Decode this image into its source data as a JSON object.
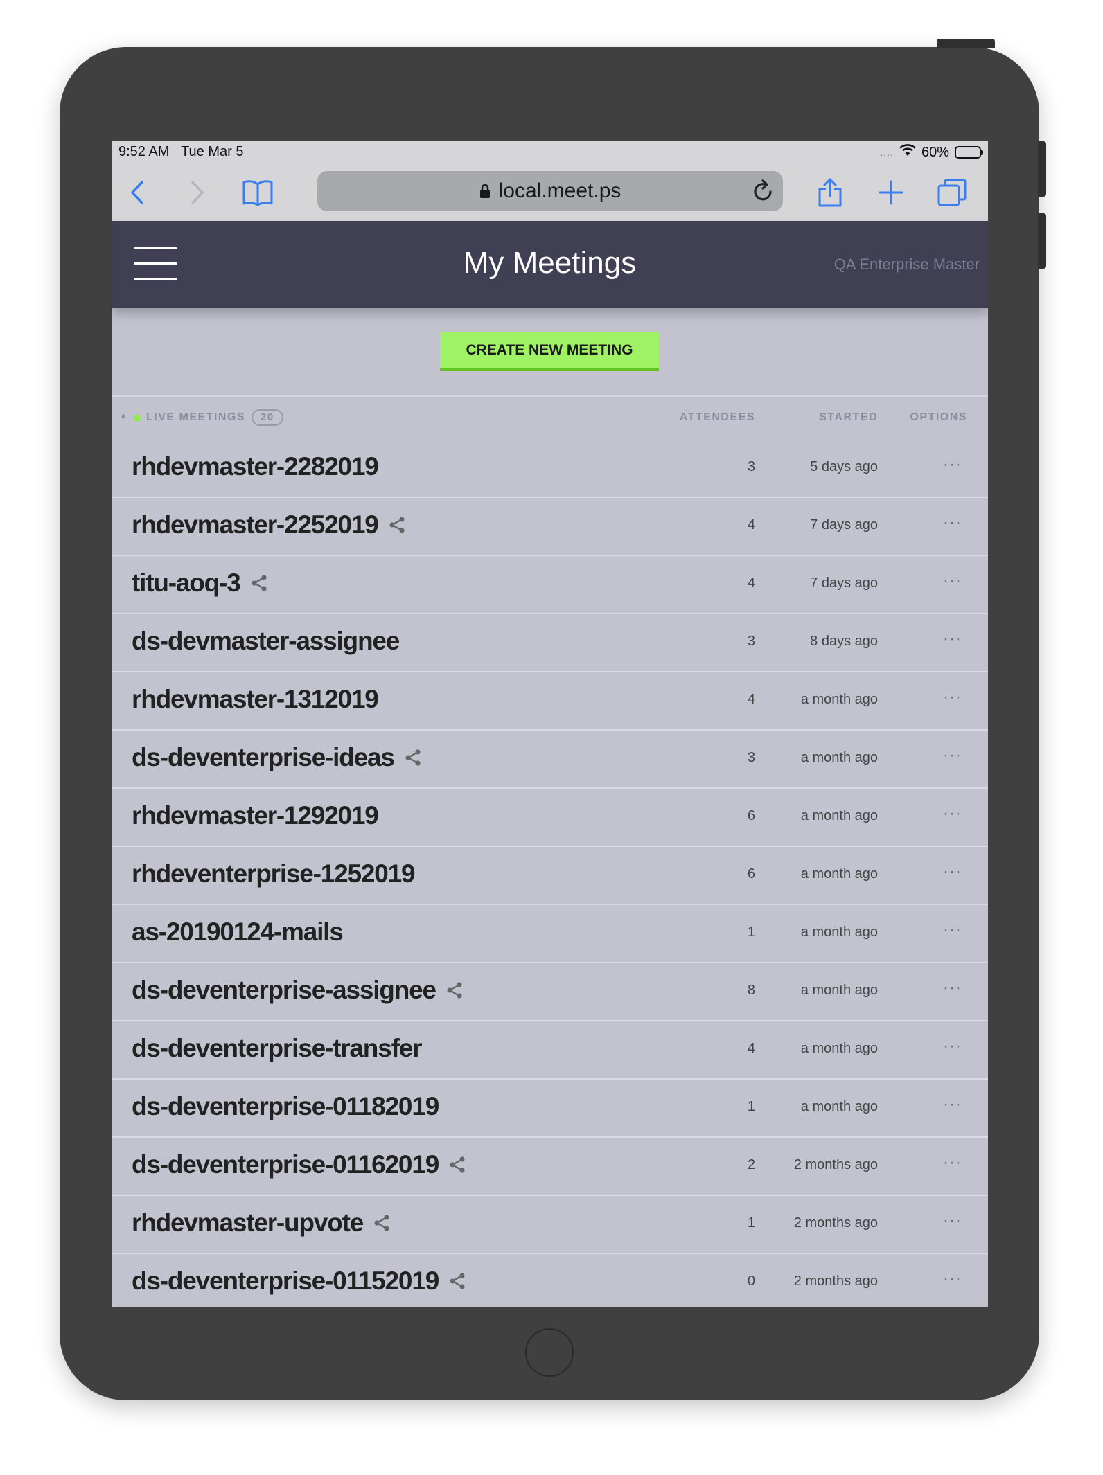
{
  "status_bar": {
    "time": "9:52 AM",
    "date": "Tue Mar 5",
    "signal": "....",
    "battery": "60%"
  },
  "browser": {
    "url": "local.meet.ps"
  },
  "header": {
    "title": "My Meetings",
    "org": "QA Enterprise Master"
  },
  "create_button": "CREATE NEW MEETING",
  "table": {
    "section_label": "LIVE MEETINGS",
    "count": "20",
    "col_attendees": "ATTENDEES",
    "col_started": "STARTED",
    "col_options": "OPTIONS",
    "options_glyph": "···",
    "rows": [
      {
        "name": "rhdevmaster-2282019",
        "shared": false,
        "attendees": "3",
        "started": "5 days ago"
      },
      {
        "name": "rhdevmaster-2252019",
        "shared": true,
        "attendees": "4",
        "started": "7 days ago"
      },
      {
        "name": "titu-aoq-3",
        "shared": true,
        "attendees": "4",
        "started": "7 days ago"
      },
      {
        "name": "ds-devmaster-assignee",
        "shared": false,
        "attendees": "3",
        "started": "8 days ago"
      },
      {
        "name": "rhdevmaster-1312019",
        "shared": false,
        "attendees": "4",
        "started": "a month ago"
      },
      {
        "name": "ds-deventerprise-ideas",
        "shared": true,
        "attendees": "3",
        "started": "a month ago"
      },
      {
        "name": "rhdevmaster-1292019",
        "shared": false,
        "attendees": "6",
        "started": "a month ago"
      },
      {
        "name": "rhdeventerprise-1252019",
        "shared": false,
        "attendees": "6",
        "started": "a month ago"
      },
      {
        "name": "as-20190124-mails",
        "shared": false,
        "attendees": "1",
        "started": "a month ago"
      },
      {
        "name": "ds-deventerprise-assignee",
        "shared": true,
        "attendees": "8",
        "started": "a month ago"
      },
      {
        "name": "ds-deventerprise-transfer",
        "shared": false,
        "attendees": "4",
        "started": "a month ago"
      },
      {
        "name": "ds-deventerprise-01182019",
        "shared": false,
        "attendees": "1",
        "started": "a month ago"
      },
      {
        "name": "ds-deventerprise-01162019",
        "shared": true,
        "attendees": "2",
        "started": "2 months ago"
      },
      {
        "name": "rhdevmaster-upvote",
        "shared": true,
        "attendees": "1",
        "started": "2 months ago"
      },
      {
        "name": "ds-deventerprise-01152019",
        "shared": true,
        "attendees": "0",
        "started": "2 months ago"
      }
    ]
  },
  "colors": {
    "header_bg": "#413f54",
    "content_bg": "#c3c3d0",
    "create_button_bg": "#9ff264",
    "live_dot": "#8dea54",
    "browser_accent": "#3a7ef0"
  }
}
